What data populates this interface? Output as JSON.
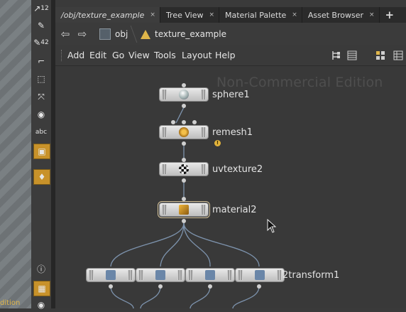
{
  "viewport": {
    "edge_text": "dition"
  },
  "shelf": {
    "items": [
      {
        "name": "tool-12-icon",
        "glyph": "↗",
        "badge": "12"
      },
      {
        "name": "brush-icon",
        "glyph": "✎",
        "badge": ""
      },
      {
        "name": "tool-42-icon",
        "glyph": "✎",
        "badge": "42"
      },
      {
        "name": "measure-icon",
        "glyph": "⌐",
        "badge": ""
      },
      {
        "name": "select-box-icon",
        "glyph": "⬚",
        "badge": ""
      },
      {
        "name": "pose-icon",
        "glyph": "⤧",
        "badge": ""
      },
      {
        "name": "record-icon",
        "glyph": "◉",
        "badge": ""
      },
      {
        "name": "text-icon",
        "glyph": "abc",
        "badge": ""
      },
      {
        "name": "image-icon",
        "glyph": "▣",
        "badge": ""
      },
      {
        "name": "pin-icon",
        "glyph": "♦",
        "badge": ""
      },
      {
        "name": "info-icon",
        "glyph": "ⓘ",
        "badge": ""
      },
      {
        "name": "grid-layout-icon",
        "glyph": "▦",
        "badge": ""
      },
      {
        "name": "eye-icon",
        "glyph": "◉",
        "badge": ""
      }
    ]
  },
  "tabs": [
    {
      "label": "/obj/texture_example",
      "close": "×"
    },
    {
      "label": "Tree View",
      "close": "×"
    },
    {
      "label": "Material Palette",
      "close": "×"
    },
    {
      "label": "Asset Browser",
      "close": "×"
    }
  ],
  "add_tab": "+",
  "pathbar": {
    "back": "⇦",
    "forward": "⇨",
    "crumbs": [
      "obj",
      "texture_example"
    ]
  },
  "menu": [
    "Add",
    "Edit",
    "Go",
    "View",
    "Tools",
    "Layout",
    "Help"
  ],
  "canvas": {
    "watermark": "Non-Commercial Edition",
    "nodes": [
      {
        "label": "sphere1"
      },
      {
        "label": "remesh1",
        "warning": "!"
      },
      {
        "label": "uvtexture2"
      },
      {
        "label": "material2"
      },
      {
        "label": "2transform1"
      }
    ]
  },
  "colors": {
    "accent": "#c8922a",
    "canvas_bg": "#393939",
    "wire": "#7d93ad"
  }
}
